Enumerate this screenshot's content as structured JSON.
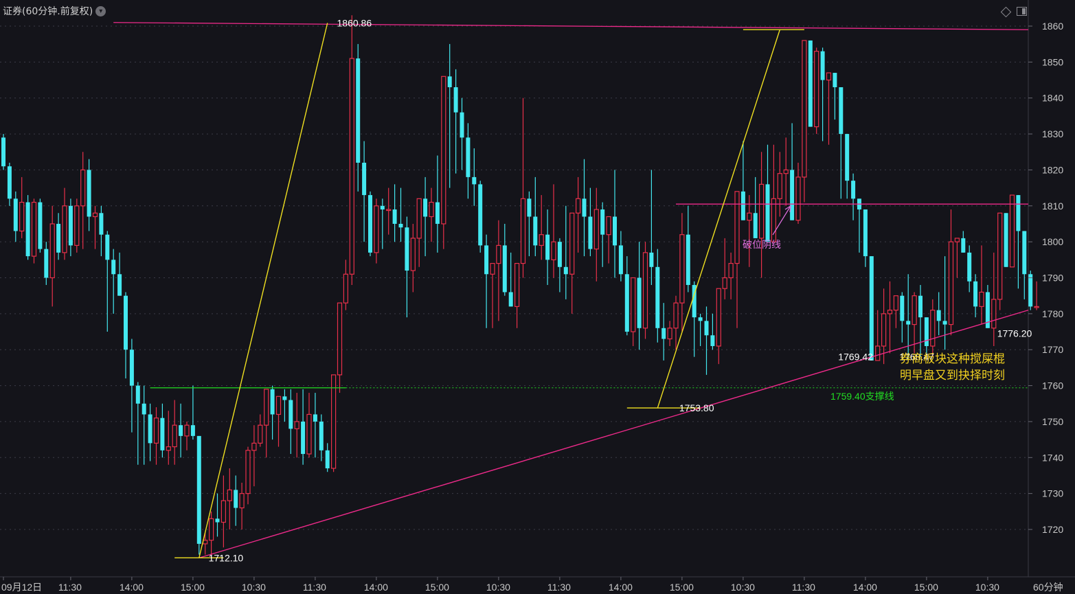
{
  "title": "证券(60分钟.前复权)",
  "period_label": "60分钟",
  "colors": {
    "background": "#14141a",
    "up": "#e8304a",
    "down": "#44e8f0",
    "pink_line": "#ee2a8a",
    "yellow_line": "#f0e020",
    "support_line": "#22dd22",
    "annotation_pink": "#e070e0",
    "annotation_yellow": "#f0d020",
    "text_axis": "#c8c8c8"
  },
  "icons": [
    "chevron-down-icon",
    "diamond-icon",
    "panel-toggle-icon"
  ],
  "chart_data": {
    "type": "candlestick",
    "ylim": [
      1710,
      1864
    ],
    "y_ticks": [
      1720,
      1730,
      1740,
      1750,
      1760,
      1770,
      1780,
      1790,
      1800,
      1810,
      1820,
      1830,
      1840,
      1850,
      1860
    ],
    "x_tick_labels": [
      {
        "label": "09月12日",
        "i": 0
      },
      {
        "label": "11:30",
        "i": 11
      },
      {
        "label": "14:00",
        "i": 21
      },
      {
        "label": "15:00",
        "i": 31
      },
      {
        "label": "10:30",
        "i": 41
      },
      {
        "label": "11:30",
        "i": 51
      },
      {
        "label": "14:00",
        "i": 61
      },
      {
        "label": "15:00",
        "i": 71
      },
      {
        "label": "10:30",
        "i": 81
      },
      {
        "label": "11:30",
        "i": 91
      },
      {
        "label": "14:00",
        "i": 101
      },
      {
        "label": "15:00",
        "i": 111
      },
      {
        "label": "10:30",
        "i": 121
      },
      {
        "label": "11:30",
        "i": 131
      },
      {
        "label": "14:00",
        "i": 141
      },
      {
        "label": "15:00",
        "i": 151
      },
      {
        "label": "10:30",
        "i": 161
      }
    ],
    "candles": [
      [
        1829,
        1830,
        1820,
        1821
      ],
      [
        1821,
        1822,
        1810,
        1812
      ],
      [
        1812,
        1814,
        1800,
        1803
      ],
      [
        1803,
        1818,
        1801,
        1811
      ],
      [
        1811,
        1813,
        1795,
        1796
      ],
      [
        1796,
        1812,
        1794,
        1811
      ],
      [
        1811,
        1812,
        1797,
        1798
      ],
      [
        1798,
        1800,
        1788,
        1790
      ],
      [
        1790,
        1810,
        1782,
        1805
      ],
      [
        1805,
        1808,
        1795,
        1797
      ],
      [
        1797,
        1815,
        1795,
        1810
      ],
      [
        1810,
        1812,
        1796,
        1799
      ],
      [
        1799,
        1812,
        1797,
        1810
      ],
      [
        1810,
        1825,
        1798,
        1820
      ],
      [
        1820,
        1823,
        1803,
        1807
      ],
      [
        1807,
        1810,
        1798,
        1808
      ],
      [
        1808,
        1810,
        1796,
        1802
      ],
      [
        1802,
        1803,
        1775,
        1795
      ],
      [
        1795,
        1798,
        1780,
        1791
      ],
      [
        1791,
        1797,
        1785,
        1785
      ],
      [
        1785,
        1786,
        1762,
        1770
      ],
      [
        1770,
        1773,
        1747,
        1760
      ],
      [
        1760,
        1761,
        1738,
        1755
      ],
      [
        1755,
        1760,
        1738,
        1752
      ],
      [
        1752,
        1755,
        1739,
        1744
      ],
      [
        1744,
        1754,
        1738,
        1751
      ],
      [
        1751,
        1755,
        1740,
        1742
      ],
      [
        1742,
        1753,
        1738,
        1743
      ],
      [
        1743,
        1756,
        1738,
        1749
      ],
      [
        1749,
        1755,
        1740,
        1746
      ],
      [
        1746,
        1750,
        1742,
        1749
      ],
      [
        1749,
        1760,
        1745,
        1746
      ],
      [
        1746,
        1746,
        1713,
        1716
      ],
      [
        1716,
        1719,
        1713,
        1717
      ],
      [
        1717,
        1725,
        1712,
        1723
      ],
      [
        1723,
        1730,
        1718,
        1722
      ],
      [
        1722,
        1735,
        1715,
        1728
      ],
      [
        1728,
        1737,
        1720,
        1731
      ],
      [
        1731,
        1735,
        1721,
        1726
      ],
      [
        1726,
        1733,
        1720,
        1730
      ],
      [
        1730,
        1743,
        1727,
        1742
      ],
      [
        1742,
        1749,
        1732,
        1744
      ],
      [
        1744,
        1752,
        1743,
        1749
      ],
      [
        1749,
        1756,
        1740,
        1759
      ],
      [
        1759,
        1760,
        1745,
        1752
      ],
      [
        1752,
        1757,
        1743,
        1757
      ],
      [
        1757,
        1759,
        1750,
        1756
      ],
      [
        1756,
        1759,
        1741,
        1748
      ],
      [
        1748,
        1758,
        1740,
        1750
      ],
      [
        1750,
        1759,
        1738,
        1741
      ],
      [
        1741,
        1758,
        1740,
        1752
      ],
      [
        1752,
        1758,
        1740,
        1750
      ],
      [
        1750,
        1752,
        1739,
        1742
      ],
      [
        1742,
        1744,
        1736,
        1737
      ],
      [
        1737,
        1746,
        1736,
        1763
      ],
      [
        1763,
        1768,
        1758,
        1783
      ],
      [
        1783,
        1795,
        1781,
        1791
      ],
      [
        1791,
        1863,
        1788,
        1851
      ],
      [
        1851,
        1855,
        1814,
        1822
      ],
      [
        1822,
        1828,
        1800,
        1813
      ],
      [
        1813,
        1814,
        1796,
        1797
      ],
      [
        1797,
        1812,
        1794,
        1810
      ],
      [
        1810,
        1812,
        1798,
        1809
      ],
      [
        1809,
        1815,
        1802,
        1809
      ],
      [
        1809,
        1816,
        1800,
        1805
      ],
      [
        1805,
        1815,
        1800,
        1804
      ],
      [
        1804,
        1807,
        1779,
        1792
      ],
      [
        1792,
        1805,
        1786,
        1801
      ],
      [
        1801,
        1812,
        1793,
        1812
      ],
      [
        1812,
        1818,
        1796,
        1807
      ],
      [
        1807,
        1815,
        1800,
        1811
      ],
      [
        1811,
        1824,
        1797,
        1805
      ],
      [
        1805,
        1834,
        1798,
        1846
      ],
      [
        1846,
        1855,
        1815,
        1843
      ],
      [
        1843,
        1848,
        1819,
        1836
      ],
      [
        1836,
        1840,
        1820,
        1829
      ],
      [
        1829,
        1833,
        1812,
        1818
      ],
      [
        1818,
        1826,
        1810,
        1816
      ],
      [
        1816,
        1817,
        1797,
        1799
      ],
      [
        1799,
        1802,
        1776,
        1791
      ],
      [
        1791,
        1792,
        1776,
        1794
      ],
      [
        1794,
        1806,
        1778,
        1799
      ],
      [
        1799,
        1805,
        1785,
        1786
      ],
      [
        1786,
        1797,
        1782,
        1782
      ],
      [
        1782,
        1791,
        1776,
        1794
      ],
      [
        1794,
        1840,
        1790,
        1812
      ],
      [
        1812,
        1814,
        1796,
        1807
      ],
      [
        1807,
        1818,
        1796,
        1799
      ],
      [
        1799,
        1813,
        1795,
        1802
      ],
      [
        1802,
        1809,
        1788,
        1795
      ],
      [
        1795,
        1816,
        1790,
        1800
      ],
      [
        1800,
        1801,
        1786,
        1793
      ],
      [
        1793,
        1810,
        1784,
        1791
      ],
      [
        1791,
        1806,
        1780,
        1808
      ],
      [
        1808,
        1818,
        1797,
        1812
      ],
      [
        1812,
        1823,
        1796,
        1807
      ],
      [
        1807,
        1815,
        1796,
        1798
      ],
      [
        1798,
        1815,
        1789,
        1809
      ],
      [
        1809,
        1811,
        1793,
        1802
      ],
      [
        1802,
        1805,
        1794,
        1807
      ],
      [
        1807,
        1820,
        1790,
        1799
      ],
      [
        1799,
        1803,
        1789,
        1791
      ],
      [
        1791,
        1796,
        1774,
        1775
      ],
      [
        1775,
        1787,
        1771,
        1790
      ],
      [
        1790,
        1800,
        1770,
        1776
      ],
      [
        1776,
        1800,
        1773,
        1797
      ],
      [
        1797,
        1820,
        1788,
        1793
      ],
      [
        1793,
        1798,
        1772,
        1776
      ],
      [
        1776,
        1783,
        1767,
        1773
      ],
      [
        1773,
        1778,
        1771,
        1776
      ],
      [
        1776,
        1785,
        1770,
        1783
      ],
      [
        1783,
        1808,
        1775,
        1802
      ],
      [
        1802,
        1810,
        1786,
        1788
      ],
      [
        1788,
        1789,
        1768,
        1779
      ],
      [
        1779,
        1780,
        1771,
        1778
      ],
      [
        1778,
        1782,
        1763,
        1774
      ],
      [
        1774,
        1780,
        1770,
        1771
      ],
      [
        1771,
        1786,
        1766,
        1787
      ],
      [
        1787,
        1801,
        1784,
        1790
      ],
      [
        1790,
        1797,
        1784,
        1794
      ],
      [
        1794,
        1807,
        1776,
        1814
      ],
      [
        1814,
        1828,
        1812,
        1806
      ],
      [
        1806,
        1813,
        1793,
        1808
      ],
      [
        1808,
        1818,
        1801,
        1801
      ],
      [
        1801,
        1825,
        1790,
        1816
      ],
      [
        1816,
        1827,
        1809,
        1800
      ],
      [
        1800,
        1827,
        1804,
        1812
      ],
      [
        1812,
        1825,
        1807,
        1819
      ],
      [
        1819,
        1829,
        1810,
        1820
      ],
      [
        1820,
        1833,
        1811,
        1806
      ],
      [
        1806,
        1822,
        1805,
        1818
      ],
      [
        1818,
        1854,
        1811,
        1856
      ],
      [
        1856,
        1855,
        1843,
        1832
      ],
      [
        1832,
        1854,
        1830,
        1853
      ],
      [
        1853,
        1854,
        1828,
        1845
      ],
      [
        1845,
        1847,
        1827,
        1847
      ],
      [
        1847,
        1841,
        1834,
        1843
      ],
      [
        1843,
        1830,
        1812,
        1830
      ],
      [
        1830,
        1822,
        1812,
        1817
      ],
      [
        1817,
        1819,
        1806,
        1812
      ],
      [
        1812,
        1809,
        1797,
        1809
      ],
      [
        1809,
        1806,
        1793,
        1796
      ],
      [
        1796,
        1791,
        1768,
        1767
      ],
      [
        1767,
        1781,
        1769,
        1771
      ],
      [
        1771,
        1787,
        1766,
        1780
      ],
      [
        1780,
        1789,
        1769,
        1781
      ],
      [
        1781,
        1785,
        1776,
        1785
      ],
      [
        1785,
        1786,
        1772,
        1778
      ],
      [
        1778,
        1791,
        1767,
        1777
      ],
      [
        1777,
        1786,
        1769,
        1785
      ],
      [
        1785,
        1788,
        1768,
        1779
      ],
      [
        1779,
        1779,
        1769,
        1771
      ],
      [
        1771,
        1784,
        1768,
        1781
      ],
      [
        1781,
        1786,
        1774,
        1778
      ],
      [
        1778,
        1796,
        1770,
        1777
      ],
      [
        1777,
        1809,
        1774,
        1800
      ],
      [
        1800,
        1801,
        1790,
        1801
      ],
      [
        1801,
        1803,
        1798,
        1797
      ],
      [
        1797,
        1799,
        1786,
        1789
      ],
      [
        1789,
        1791,
        1779,
        1782
      ],
      [
        1782,
        1799,
        1777,
        1786
      ],
      [
        1786,
        1788,
        1780,
        1776
      ],
      [
        1776,
        1797,
        1771,
        1784
      ],
      [
        1784,
        1800,
        1781,
        1808
      ],
      [
        1808,
        1806,
        1796,
        1793
      ],
      [
        1793,
        1812,
        1794,
        1813
      ],
      [
        1813,
        1810,
        1787,
        1803
      ],
      [
        1803,
        1803,
        1784,
        1791
      ],
      [
        1791,
        1792,
        1781,
        1782
      ],
      [
        1782,
        1789,
        1781,
        1782
      ]
    ],
    "horizontal_lines": [
      {
        "name": "top-resistance-line",
        "y_start": 1861,
        "y_end": 1859,
        "i_start": 18,
        "i_end": 178
      },
      {
        "name": "breakdown-line",
        "y": 1810.5,
        "i_start": 110,
        "i_end": 178
      },
      {
        "name": "support-line",
        "y": 1759.4,
        "i_start": 24,
        "i_end": 56
      }
    ],
    "trend_lines": [
      {
        "name": "rising-support-trendline",
        "from": {
          "i": 32,
          "y": 1712.1
        },
        "to": {
          "i": 178,
          "y": 1781
        }
      },
      {
        "name": "yellow-rise-line-1",
        "from": {
          "i": 32,
          "y": 1712.1
        },
        "to": {
          "i": 53,
          "y": 1860.86
        }
      },
      {
        "name": "yellow-rise-line-2",
        "from": {
          "i": 107,
          "y": 1753.8
        },
        "to": {
          "i": 127,
          "y": 1859
        }
      }
    ],
    "marker_segments": [
      {
        "name": "low-1712-marker",
        "y": 1712.1,
        "i_start": 28,
        "i_end": 36
      },
      {
        "name": "low-1753-marker",
        "y": 1753.8,
        "i_start": 102,
        "i_end": 114
      },
      {
        "name": "high-1859-marker",
        "y": 1859,
        "i_start": 121,
        "i_end": 131
      }
    ],
    "price_labels": [
      {
        "text": "1860.86",
        "i": 55,
        "y": 1860.86
      },
      {
        "text": "1712.10",
        "i": 34,
        "y": 1712.1
      },
      {
        "text": "1753.80",
        "i": 111,
        "y": 1753.8
      },
      {
        "text": "1769.42",
        "i": 137,
        "y": 1768
      },
      {
        "text": "1768.47",
        "i": 147,
        "y": 1768
      },
      {
        "text": "1776.20",
        "i": 163,
        "y": 1774.5
      }
    ],
    "annotations": [
      {
        "text": "破位阴线",
        "type": "arrow-label"
      },
      {
        "text": "1759.40支撑线"
      },
      {
        "text": "券商板块这种搅屎棍"
      },
      {
        "text": "明早盘又到抉择时刻"
      }
    ]
  }
}
